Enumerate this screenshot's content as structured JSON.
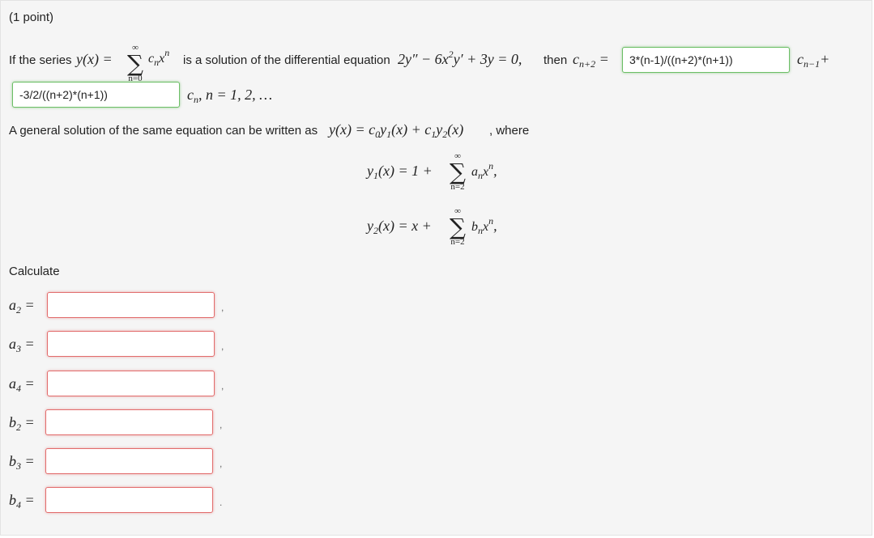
{
  "points": "(1 point)",
  "problem": {
    "intro": "If the series",
    "mid": "is a solution of the differential equation",
    "then": "then",
    "ans_c1": "3*(n-1)/((n+2)*(n+1))",
    "ans_c2": "-3/2/((n+2)*(n+1))",
    "general_text": "A general solution of the same equation can be written as",
    "where": ", where",
    "calculate": "Calculate"
  },
  "colors": {
    "correct_border": "#6cbf66",
    "incorrect_border": "#e26c6c",
    "panel_bg": "#f5f5f5"
  },
  "fields": [
    {
      "label": "a",
      "sub": "2",
      "value": "",
      "punct": ","
    },
    {
      "label": "a",
      "sub": "3",
      "value": "",
      "punct": ","
    },
    {
      "label": "a",
      "sub": "4",
      "value": "",
      "punct": ","
    },
    {
      "label": "b",
      "sub": "2",
      "value": "",
      "punct": ","
    },
    {
      "label": "b",
      "sub": "3",
      "value": "",
      "punct": ","
    },
    {
      "label": "b",
      "sub": "4",
      "value": "",
      "punct": "."
    }
  ]
}
